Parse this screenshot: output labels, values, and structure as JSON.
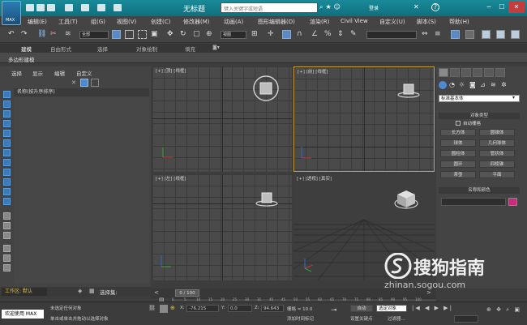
{
  "title_bar": {
    "app_badge": "MAX",
    "title": "无标题",
    "search_placeholder": "键入关键字或短语",
    "login": "登录",
    "help": "?"
  },
  "menu": [
    "编辑(E)",
    "工具(T)",
    "组(G)",
    "视图(V)",
    "创建(C)",
    "修改器(M)",
    "动画(A)",
    "图形编辑器(D)",
    "渲染(R)",
    "Civil View",
    "自定义(U)",
    "脚本(S)",
    "帮助(H)"
  ],
  "toolbar": {
    "selection_filter": "全部",
    "reference_coord": "视图"
  },
  "ribbon": {
    "tabs": [
      "建模",
      "自由形式",
      "选择",
      "对象绘制",
      "填充"
    ],
    "sub_label": "多边形建模"
  },
  "explorer": {
    "tabs": [
      "选择",
      "显示",
      "编辑",
      "自定义"
    ],
    "column_header": "名称(按升序排序)",
    "workspace_label": "工作区: 默认",
    "selection_set_label": "选择集:"
  },
  "viewports": [
    {
      "label": "[+] [顶] [线框]"
    },
    {
      "label": "[+] [前] [线框]"
    },
    {
      "label": "[+] [左] [线框]"
    },
    {
      "label": "[+] [透视] [真实]"
    }
  ],
  "command_panel": {
    "dropdown": "标准基本体",
    "object_type_header": "对象类型",
    "autogrid": "自动栅格",
    "buttons": [
      "长方体",
      "圆锥体",
      "球体",
      "几何球体",
      "圆柱体",
      "管状体",
      "圆环",
      "四棱锥",
      "茶壶",
      "平面"
    ],
    "name_color_header": "名称和颜色",
    "color": "#cc2a7a"
  },
  "timeline": {
    "frame_display": "0 / 100",
    "ticks": [
      "0",
      "5",
      "10",
      "15",
      "20",
      "25",
      "30",
      "35",
      "40",
      "45",
      "50",
      "55",
      "60",
      "65",
      "70",
      "75",
      "80",
      "85",
      "90",
      "95",
      "100"
    ]
  },
  "status": {
    "welcome": "欢迎使用 MAX",
    "line1": "未选定任何对象",
    "line2": "单击或单击并拖动以选择对象",
    "x_label": "X:",
    "x_value": "-76.215",
    "y_label": "Y:",
    "y_value": "0.0",
    "z_label": "Z:",
    "z_value": "94.643",
    "grid_label": "栅格 = 10.0",
    "add_time_tag": "添加时间标记",
    "auto_key": "自动",
    "selected_dropdown": "选定对象",
    "set_key": "设置关键点",
    "filters": "过滤器..."
  },
  "watermark": {
    "brand": "搜狗指南",
    "url": "zhinan.sogou.com"
  }
}
